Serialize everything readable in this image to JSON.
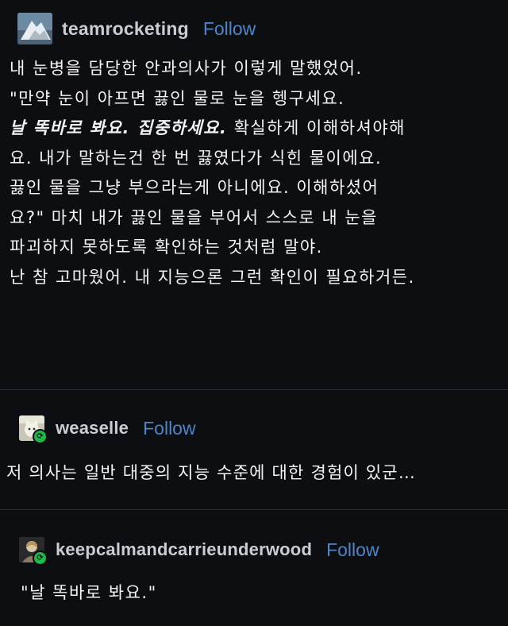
{
  "posts": [
    {
      "username": "teamrocketing",
      "follow_label": "Follow",
      "avatar_icon": "mountain-avatar-icon",
      "lines": [
        {
          "plain": "내 눈병을 담당한 안과의사가 이렇게 말했었어."
        },
        {
          "plain": "\"만약 눈이 아프면 끓인 물로 눈을 헹구세요."
        },
        {
          "emph": "날 똑바로 봐요. 집중하세요.",
          "plain": " 확실하게 이해하셔야해"
        },
        {
          "plain": "요. 내가 말하는건 한 번 끓였다가 식힌 물이에요."
        },
        {
          "plain": "끓인 물을 그냥 부으라는게 아니에요. 이해하셨어"
        },
        {
          "plain": "요?\" 마치 내가 끓인 물을 부어서 스스로 내 눈을"
        },
        {
          "plain": "파괴하지 못하도록 확인하는 것처럼 말야."
        },
        {
          "plain": "난 참 고마웠어. 내 지능으론 그런 확인이 필요하거든."
        }
      ]
    },
    {
      "username": "weaselle",
      "follow_label": "Follow",
      "avatar_icon": "cat-avatar-icon",
      "reblog_icon": "reblog-icon",
      "lines": [
        {
          "plain": "저 의사는 일반 대중의 지능 수준에 대한 경험이 있군…"
        }
      ]
    },
    {
      "username": "keepcalmandcarrieunderwood",
      "follow_label": "Follow",
      "avatar_icon": "person-avatar-icon",
      "reblog_icon": "reblog-icon",
      "lines": [
        {
          "plain": "\"날 똑바로 봐요.\""
        }
      ]
    }
  ],
  "colors": {
    "background": "#0d0e12",
    "username": "#c9cdd2",
    "follow": "#4d86c8",
    "text": "#f4f4f4",
    "reblog_badge": "#1fb84b"
  }
}
